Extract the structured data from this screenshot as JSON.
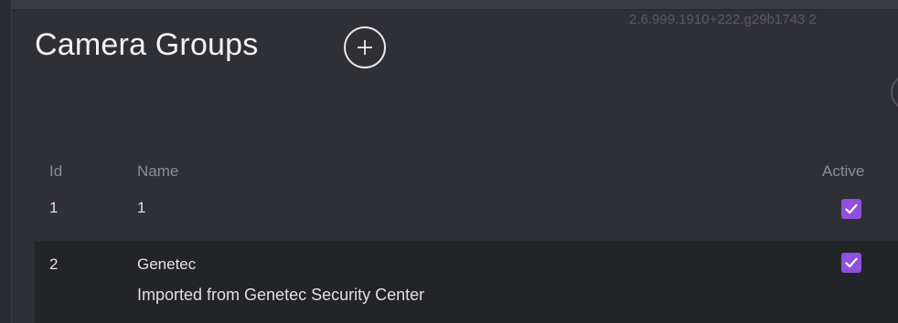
{
  "header": {
    "title": "Camera Groups",
    "version": "2.6.999.1910+222.g29b1743 2"
  },
  "table": {
    "columns": [
      "Id",
      "Name",
      "Active"
    ],
    "rows": [
      {
        "id": "1",
        "name": "1",
        "description": "",
        "active": true
      },
      {
        "id": "2",
        "name": "Genetec",
        "description": "Imported from Genetec Security Center",
        "active": true
      }
    ]
  },
  "icons": {
    "add": "plus-icon",
    "check": "checkmark-icon",
    "partial_edge": "circle-icon"
  },
  "colors": {
    "background": "#2f3035",
    "selected_row": "#232428",
    "checkbox": "#8f4fe0",
    "header_text": "#8d8e94"
  }
}
